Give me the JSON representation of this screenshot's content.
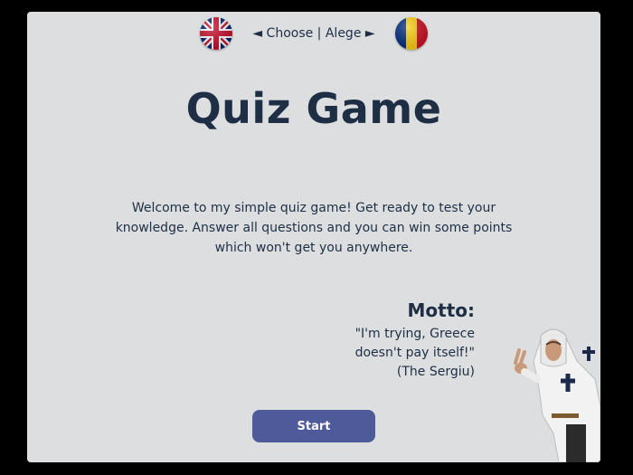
{
  "language_bar": {
    "choose_label": "◄ Choose | Alege ►",
    "flags": [
      {
        "name": "uk-flag-icon",
        "colors": {
          "blue": "#012169",
          "red": "#C8102E",
          "white": "#FFFFFF"
        }
      },
      {
        "name": "romania-flag-icon",
        "colors": {
          "blue": "#002B7F",
          "yellow": "#FCD116",
          "red": "#CE1126"
        }
      }
    ]
  },
  "main": {
    "title": "Quiz Game",
    "welcome_text": "Welcome to my simple quiz game! Get ready to test your knowledge. Answer all questions and you can win some points which won't get you anywhere.",
    "motto": {
      "heading": "Motto:",
      "lines": [
        "\"I'm trying, Greece",
        "doesn't pay itself!\"",
        "(The Sergiu)"
      ]
    },
    "start_button_label": "Start"
  },
  "theme": {
    "background": "#000000",
    "card": "#DCDEDF",
    "text": "#1E2F45",
    "button": "#4E5A9A"
  }
}
